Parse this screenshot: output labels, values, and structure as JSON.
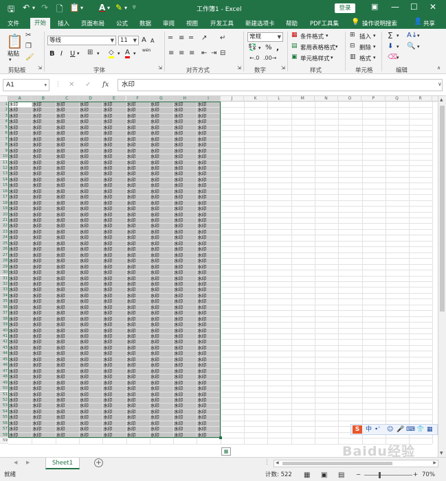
{
  "window": {
    "title": "工作簿1 - Excel",
    "login_label": "登录",
    "icons": [
      "save-icon",
      "undo-icon",
      "redo-icon",
      "new-doc-icon",
      "paste-icon",
      "font-color-icon",
      "highlight-icon",
      "customize-icon"
    ],
    "controls": [
      "ribbon-options-icon",
      "minimize-icon",
      "maximize-icon",
      "close-icon"
    ]
  },
  "tabs": [
    {
      "label": "文件",
      "active": false
    },
    {
      "label": "开始",
      "active": true
    },
    {
      "label": "插入",
      "active": false
    },
    {
      "label": "页面布局",
      "active": false
    },
    {
      "label": "公式",
      "active": false
    },
    {
      "label": "数据",
      "active": false
    },
    {
      "label": "审阅",
      "active": false
    },
    {
      "label": "视图",
      "active": false
    },
    {
      "label": "开发工具",
      "active": false
    },
    {
      "label": "新建选项卡",
      "active": false
    },
    {
      "label": "帮助",
      "active": false
    },
    {
      "label": "PDF工具集",
      "active": false
    }
  ],
  "tell_me": "操作说明搜索",
  "share": "共享",
  "ribbon": {
    "clipboard": {
      "group": "剪贴板",
      "paste": "粘贴"
    },
    "font": {
      "group": "字体",
      "font_name": "等线",
      "font_size": "11",
      "bold": "B",
      "italic": "I",
      "underline": "U",
      "grow": "A",
      "shrink": "A",
      "color_a": "A",
      "wen": "wén"
    },
    "align": {
      "group": "对齐方式"
    },
    "number": {
      "group": "数字",
      "format": "常规",
      "percent": "%",
      "comma": ","
    },
    "styles": {
      "group": "样式",
      "cond": "条件格式",
      "table": "套用表格格式",
      "cell": "单元格样式"
    },
    "cells": {
      "group": "单元格",
      "insert": "插入",
      "delete": "删除",
      "format": "格式"
    },
    "edit": {
      "group": "编辑"
    }
  },
  "formula_bar": {
    "name_box": "A1",
    "value": "水印",
    "fx": "fx"
  },
  "grid": {
    "columns": [
      "A",
      "B",
      "C",
      "D",
      "E",
      "F",
      "G",
      "H",
      "I",
      "J",
      "K",
      "L",
      "M",
      "N",
      "O",
      "P",
      "Q",
      "R"
    ],
    "rows": 59,
    "filled_cols": 9,
    "filled_rows": 58,
    "cell_text": "水印"
  },
  "sheet": {
    "tab": "Sheet1",
    "add": "+"
  },
  "status": {
    "ready": "就绪",
    "count": "计数: 522",
    "zoom": "70%"
  },
  "overlay": {
    "ime_label": "中",
    "watermark": "Baidu经验"
  }
}
